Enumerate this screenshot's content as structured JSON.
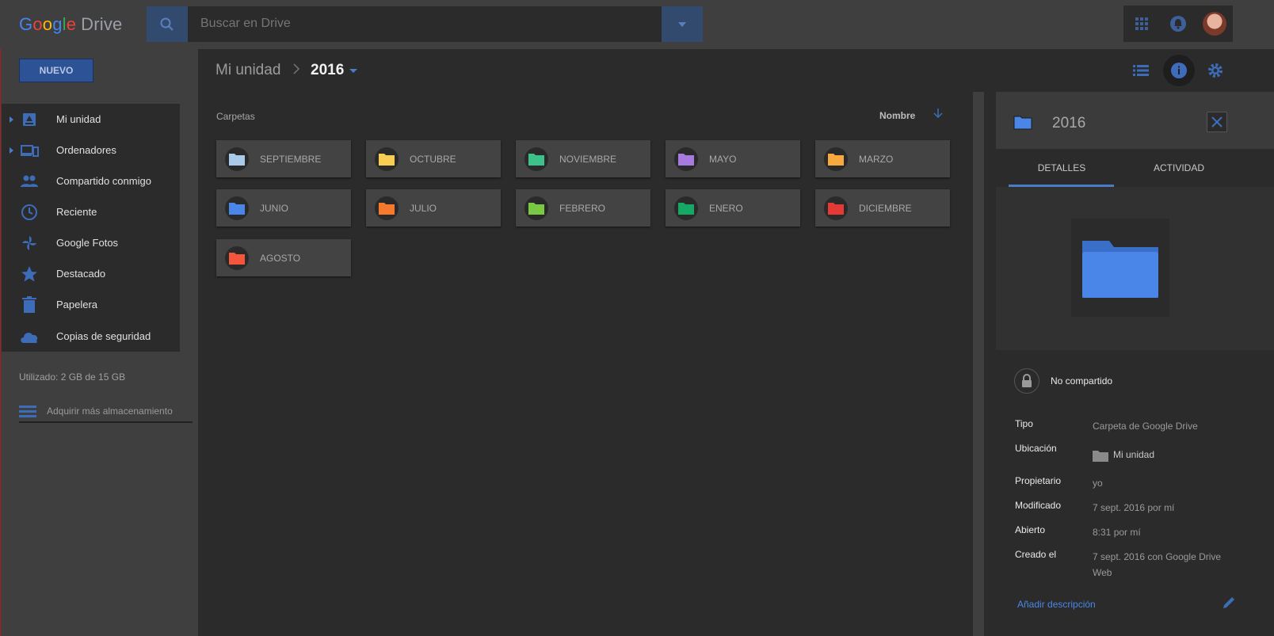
{
  "app": {
    "logo_letters": [
      "G",
      "o",
      "o",
      "g",
      "l",
      "e"
    ],
    "logo_product": "Drive"
  },
  "search": {
    "placeholder": "Buscar en Drive",
    "icon": "search-icon",
    "dropdown_icon": "chevron-down-icon"
  },
  "topbar": {
    "apps_icon": "apps-icon",
    "notifications_icon": "bell-icon",
    "avatar": "avatar"
  },
  "sidebar": {
    "new_label": "NUEVO",
    "items": [
      {
        "label": "Mi unidad",
        "icon": "drive-icon",
        "expandable": true
      },
      {
        "label": "Ordenadores",
        "icon": "devices-icon",
        "expandable": true
      },
      {
        "label": "Compartido conmigo",
        "icon": "people-icon",
        "expandable": false
      },
      {
        "label": "Reciente",
        "icon": "clock-icon",
        "expandable": false
      },
      {
        "label": "Google Fotos",
        "icon": "pinwheel-icon",
        "expandable": false
      },
      {
        "label": "Destacado",
        "icon": "star-icon",
        "expandable": false
      },
      {
        "label": "Papelera",
        "icon": "trash-icon",
        "expandable": false
      },
      {
        "label": "Copias de seguridad",
        "icon": "cloud-icon",
        "expandable": false
      }
    ],
    "storage_text": "Utilizado: 2 GB de 15 GB",
    "buy_storage_label": "Adquirir más almacenamiento"
  },
  "breadcrumb": {
    "parent": "Mi unidad",
    "current": "2016"
  },
  "main": {
    "section_label": "Carpetas",
    "sort_label": "Nombre",
    "folders": [
      {
        "name": "SEPTIEMBRE",
        "color": "#a9cbe8"
      },
      {
        "name": "OCTUBRE",
        "color": "#f7cd54"
      },
      {
        "name": "NOVIEMBRE",
        "color": "#3dc08a"
      },
      {
        "name": "MAYO",
        "color": "#a77ae0"
      },
      {
        "name": "MARZO",
        "color": "#f7a83e"
      },
      {
        "name": "JUNIO",
        "color": "#4a86e8"
      },
      {
        "name": "JULIO",
        "color": "#f57a2e"
      },
      {
        "name": "FEBRERO",
        "color": "#7ac943"
      },
      {
        "name": "ENERO",
        "color": "#16a765"
      },
      {
        "name": "DICIEMBRE",
        "color": "#e53935"
      },
      {
        "name": "AGOSTO",
        "color": "#f4553b"
      }
    ]
  },
  "details": {
    "title": "2016",
    "folder_color": "#4a86e8",
    "tabs": [
      "DETALLES",
      "ACTIVIDAD"
    ],
    "active_tab": "DETALLES",
    "sharing": "No compartido",
    "properties": [
      {
        "key": "Tipo",
        "value": "Carpeta de Google Drive"
      },
      {
        "key": "Ubicación",
        "value": "Mi unidad"
      },
      {
        "key": "Propietario",
        "value": "yo"
      },
      {
        "key": "Modificado",
        "value": "7 sept. 2016 por mí"
      },
      {
        "key": "Abierto",
        "value": "8:31 por mí"
      },
      {
        "key": "Creado el",
        "value": "7 sept. 2016 con Google Drive Web"
      }
    ],
    "add_description": "Añadir descripción"
  },
  "colors": {
    "accent": "#4a7cc9",
    "link": "#4a86e8",
    "surface": "#2b2b2b",
    "chrome": "#3f3f3f"
  }
}
